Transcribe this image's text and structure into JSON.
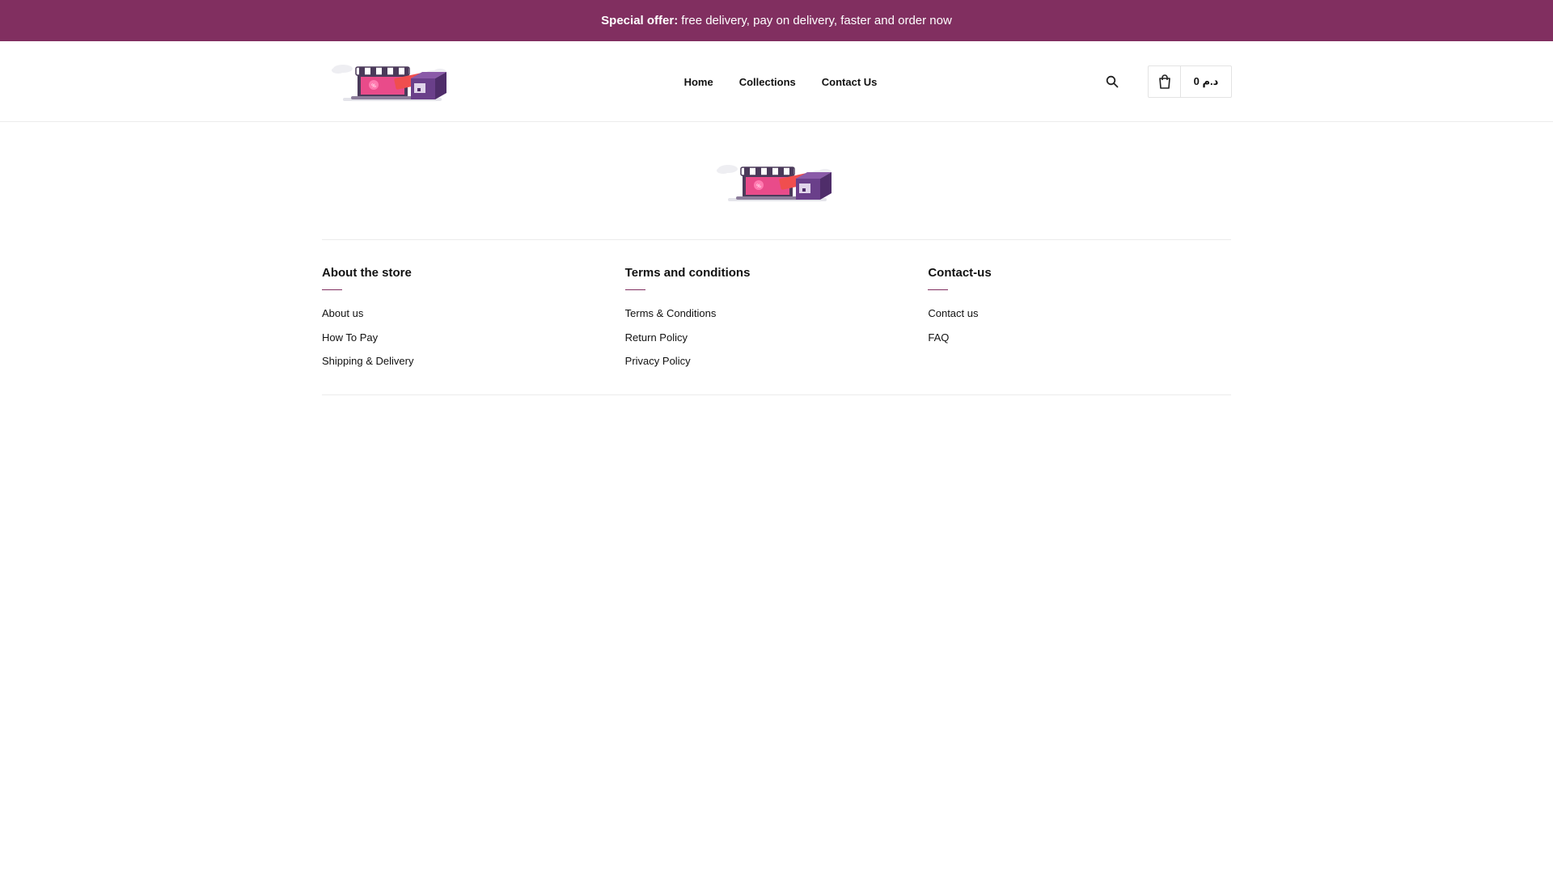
{
  "announcement": {
    "bold": "Special offer:",
    "text": "free delivery, pay on delivery, faster and order now",
    "bg_color": "#812f60"
  },
  "header": {
    "logo_icon": "storefront-illustration-icon",
    "nav": [
      {
        "label": "Home"
      },
      {
        "label": "Collections"
      },
      {
        "label": "Contact Us"
      }
    ],
    "search_icon": "search-icon",
    "cart_icon": "bag-icon",
    "cart_total": "0 د.م"
  },
  "footer": {
    "logo_icon": "storefront-illustration-icon",
    "columns": [
      {
        "title": "About the store",
        "links": [
          "About us",
          "How To Pay",
          "Shipping & Delivery"
        ]
      },
      {
        "title": "Terms and conditions",
        "links": [
          "Terms & Conditions",
          "Return Policy",
          "Privacy Policy"
        ]
      },
      {
        "title": "Contact-us",
        "links": [
          "Contact us",
          "FAQ"
        ]
      }
    ],
    "accent_color": "#812f60"
  }
}
